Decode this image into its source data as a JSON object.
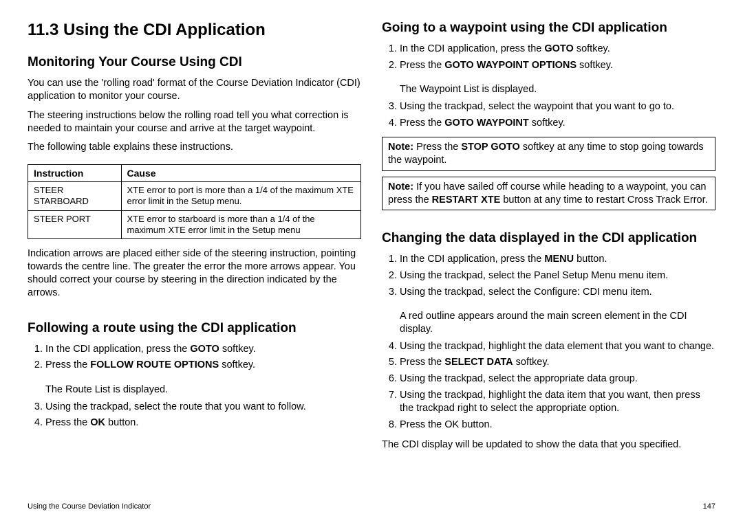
{
  "left": {
    "h1": "11.3 Using the CDI Application",
    "s1": {
      "h2": "Monitoring Your Course Using CDI",
      "p1": "You can use the 'rolling road' format of the Course Deviation Indicator (CDI) application to monitor your course.",
      "p2": "The steering instructions below the rolling road tell you what correction is needed to maintain your course and arrive at the target waypoint.",
      "p3": "The following table explains these instructions.",
      "table": {
        "h_instr": "Instruction",
        "h_cause": "Cause",
        "r1_instr": "STEER STARBOARD",
        "r1_cause": "XTE error to port is more than a 1/4 of the maximum XTE error limit in the Setup menu.",
        "r2_instr": "STEER PORT",
        "r2_cause": "XTE error to starboard is more than a 1/4 of the maximum XTE error limit in the Setup menu"
      },
      "p4": "Indication arrows are placed either side of the steering instruction, pointing towards the centre line. The greater the error the more arrows appear. You should correct your course by steering in the direction indicated by the arrows."
    },
    "s2": {
      "h2": "Following a route using the CDI application",
      "li1_a": "In the CDI application, press the ",
      "li1_b": "GOTO",
      "li1_c": " softkey.",
      "li2_a": "Press the ",
      "li2_b": "FOLLOW ROUTE OPTIONS",
      "li2_c": " softkey.",
      "ind1": "The Route List is displayed.",
      "li3": "Using the trackpad, select the route that you want to follow.",
      "li4_a": "Press the ",
      "li4_b": "OK",
      "li4_c": " button."
    }
  },
  "right": {
    "s3": {
      "h2": "Going to a waypoint using the CDI application",
      "li1_a": "In the CDI application, press the ",
      "li1_b": "GOTO",
      "li1_c": " softkey.",
      "li2_a": "Press the ",
      "li2_b": "GOTO WAYPOINT OPTIONS",
      "li2_c": " softkey.",
      "ind1": "The Waypoint List is displayed.",
      "li3": "Using the trackpad, select the waypoint that you want to go to.",
      "li4_a": "Press the ",
      "li4_b": "GOTO WAYPOINT",
      "li4_c": " softkey.",
      "note1_label": "Note: ",
      "note1_a": "Press the ",
      "note1_b": "STOP GOTO",
      "note1_c": " softkey at any time to stop going towards the waypoint.",
      "note2_label": "Note: ",
      "note2_a": "If you have sailed off course while heading to a waypoint, you can press the ",
      "note2_b": "RESTART XTE",
      "note2_c": " button at any time to restart Cross Track Error."
    },
    "s4": {
      "h2": "Changing the data displayed in the CDI application",
      "li1_a": "In the CDI application, press the ",
      "li1_b": "MENU",
      "li1_c": " button.",
      "li2": "Using the trackpad, select the Panel Setup Menu menu item.",
      "li3": "Using the trackpad, select the Configure: CDI menu item.",
      "ind1": "A red outline appears around the main screen element in the CDI display.",
      "li4": "Using the trackpad, highlight the data element that you want to change.",
      "li5_a": "Press the ",
      "li5_b": "SELECT DATA",
      "li5_c": " softkey.",
      "li6": "Using the trackpad, select the appropriate data group.",
      "li7": "Using the trackpad, highlight the data item that you want, then press the trackpad right to select the appropriate option.",
      "li8": "Press the OK button.",
      "p_end": "The CDI display will be updated to show the data that you specified."
    }
  },
  "footer": {
    "left": "Using the Course Deviation Indicator",
    "right": "147"
  }
}
